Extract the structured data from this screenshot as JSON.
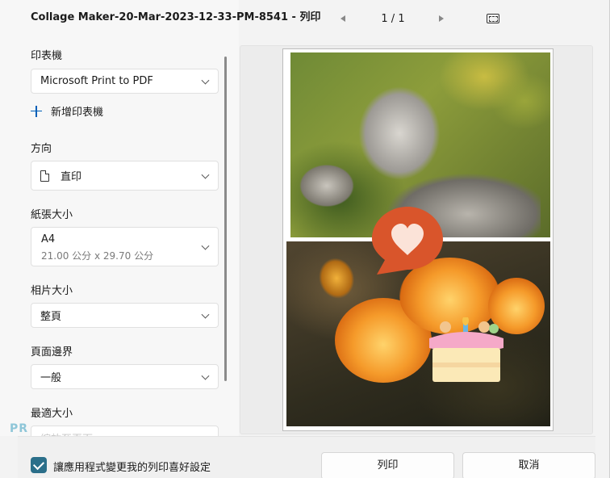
{
  "window": {
    "title": "Collage Maker-20-Mar-2023-12-33-PM-8541 - 列印"
  },
  "preview_nav": {
    "page_indicator": "1 / 1"
  },
  "settings": {
    "printer": {
      "label": "印表機",
      "value": "Microsoft Print to PDF"
    },
    "add_printer": {
      "label": "新增印表機"
    },
    "orientation": {
      "label": "方向",
      "value": "直印"
    },
    "paper_size": {
      "label": "紙張大小",
      "value": "A4",
      "detail": "21.00 公分 x 29.70 公分"
    },
    "photo_size": {
      "label": "相片大小",
      "value": "整頁"
    },
    "margins": {
      "label": "頁面邊界",
      "value": "一般"
    },
    "fit": {
      "label": "最適大小",
      "value": "縮放至頁面"
    }
  },
  "footer": {
    "checkbox_label": "讓應用程式變更我的列印喜好設定",
    "checkbox_checked": true,
    "print_button": "列印",
    "cancel_button": "取消"
  },
  "watermark": {
    "text": "PR"
  },
  "colors": {
    "accent": "#2b6f8a",
    "link": "#005fb8",
    "bubble": "#d9552b"
  },
  "icons": {
    "add": "plus-icon",
    "orientation": "document-icon",
    "dropdown": "chevron-down-icon",
    "fit_page": "fit-to-window-icon"
  }
}
